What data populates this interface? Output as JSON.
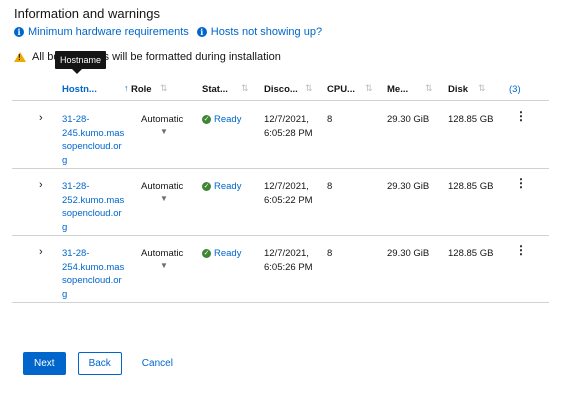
{
  "section": {
    "title": "Information and warnings"
  },
  "links": [
    {
      "label": "Minimum hardware requirements",
      "icon": "info-icon"
    },
    {
      "label": "Hosts not showing up?",
      "icon": "info-icon"
    }
  ],
  "warning": {
    "text": "All bootable disks will be formatted during installation",
    "visible_prefix": "All bo",
    "visible_suffix": "s will be formatted during installation"
  },
  "tooltip": {
    "text": "Hostname"
  },
  "table": {
    "columns": [
      {
        "label": "Hostn...",
        "sort": "↑"
      },
      {
        "label": "Role",
        "sort": "⇅"
      },
      {
        "label": "Stat...",
        "sort": "⇅"
      },
      {
        "label": "Disco...",
        "sort": "⇅"
      },
      {
        "label": "CPU...",
        "sort": "⇅"
      },
      {
        "label": "Me...",
        "sort": "⇅"
      },
      {
        "label": "Disk",
        "sort": "⇅"
      }
    ],
    "column_count_label": "(3)",
    "rows": [
      {
        "hostname": "31-28-245.kumo.massopencloud.org",
        "hostname_lines": [
          "31-28-",
          "245.kumo.mas",
          "sopencloud.or",
          "g"
        ],
        "role": "Automatic",
        "status": "Ready",
        "discovered": [
          "12/7/2021,",
          "6:05:28 PM"
        ],
        "cpu": "8",
        "memory": "29.30 GiB",
        "disk": "128.85 GB"
      },
      {
        "hostname": "31-28-252.kumo.massopencloud.org",
        "hostname_lines": [
          "31-28-",
          "252.kumo.mas",
          "sopencloud.or",
          "g"
        ],
        "role": "Automatic",
        "status": "Ready",
        "discovered": [
          "12/7/2021,",
          "6:05:22 PM"
        ],
        "cpu": "8",
        "memory": "29.30 GiB",
        "disk": "128.85 GB"
      },
      {
        "hostname": "31-28-254.kumo.massopencloud.org",
        "hostname_lines": [
          "31-28-",
          "254.kumo.mas",
          "sopencloud.or",
          "g"
        ],
        "role": "Automatic",
        "status": "Ready",
        "discovered": [
          "12/7/2021,",
          "6:05:26 PM"
        ],
        "cpu": "8",
        "memory": "29.30 GiB",
        "disk": "128.85 GB"
      }
    ]
  },
  "footer": {
    "next_label": "Next",
    "back_label": "Back",
    "cancel_label": "Cancel"
  },
  "colors": {
    "link": "#0066cc",
    "ready": "#3e8635",
    "warning": "#f0ab00",
    "tooltip_bg": "#151515"
  }
}
